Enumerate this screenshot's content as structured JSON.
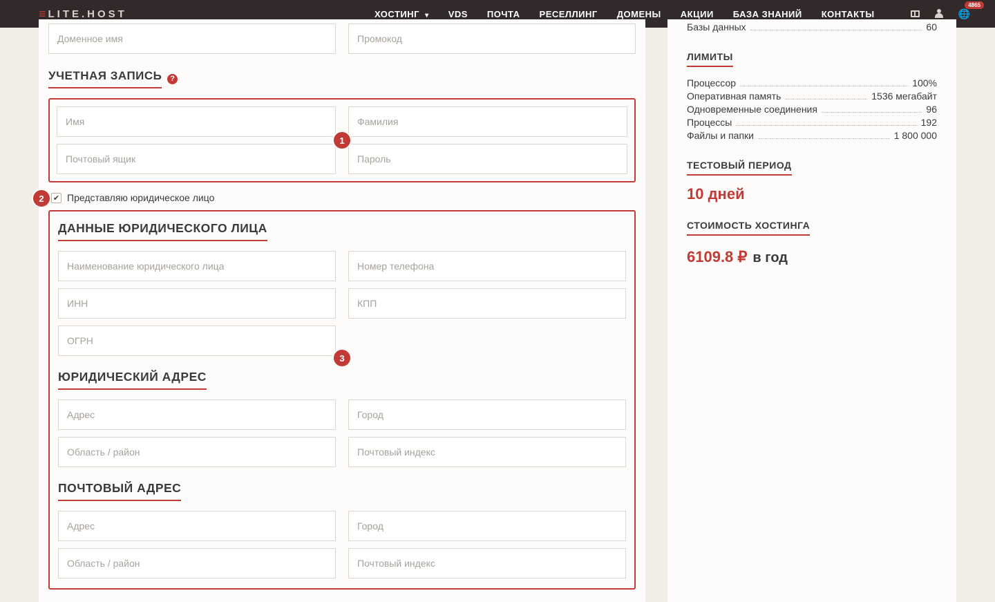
{
  "logo": {
    "mark": "≡",
    "text": "LITE.HOST"
  },
  "nav": {
    "items": [
      {
        "label": "ХОСТИНГ",
        "hasDropdown": true
      },
      {
        "label": "VDS"
      },
      {
        "label": "ПОЧТА"
      },
      {
        "label": "РЕСЕЛЛИНГ"
      },
      {
        "label": "ДОМЕНЫ"
      },
      {
        "label": "АКЦИИ"
      },
      {
        "label": "БАЗА ЗНАНИЙ"
      },
      {
        "label": "КОНТАКТЫ"
      }
    ],
    "badge": "4865"
  },
  "form": {
    "topRow": {
      "domain": "Доменное имя",
      "promo": "Промокод"
    },
    "accountTitle": "УЧЕТНАЯ ЗАПИСЬ",
    "account": {
      "firstName": "Имя",
      "lastName": "Фамилия",
      "email": "Почтовый ящик",
      "password": "Пароль"
    },
    "legalCheckbox": "Представляю юридическое лицо",
    "legal": {
      "title": "ДАННЫЕ ЮРИДИЧЕСКОГО ЛИЦА",
      "name": "Наименование юридического лица",
      "phone": "Номер телефона",
      "inn": "ИНН",
      "kpp": "КПП",
      "ogrn": "ОГРН",
      "legalAddrTitle": "ЮРИДИЧЕСКИЙ АДРЕС",
      "postAddrTitle": "ПОЧТОВЫЙ АДРЕС",
      "address": "Адрес",
      "city": "Город",
      "region": "Область / район",
      "postcode": "Почтовый индекс"
    },
    "badges": {
      "b1": "1",
      "b2": "2",
      "b3": "3"
    }
  },
  "sidebar": {
    "topRow": {
      "label": "Базы данных",
      "value": "60"
    },
    "limitsTitle": "ЛИМИТЫ",
    "limits": [
      {
        "label": "Процессор",
        "value": "100%"
      },
      {
        "label": "Оперативная память",
        "value": "1536 мегабайт"
      },
      {
        "label": "Одновременные соединения",
        "value": "96"
      },
      {
        "label": "Процессы",
        "value": "192"
      },
      {
        "label": "Файлы и папки",
        "value": "1 800 000"
      }
    ],
    "trialTitle": "ТЕСТОВЫЙ ПЕРИОД",
    "trialValue": "10 дней",
    "priceTitle": "СТОИМОСТЬ ХОСТИНГА",
    "price": "6109.8 ₽",
    "priceSuffix": "в год"
  }
}
